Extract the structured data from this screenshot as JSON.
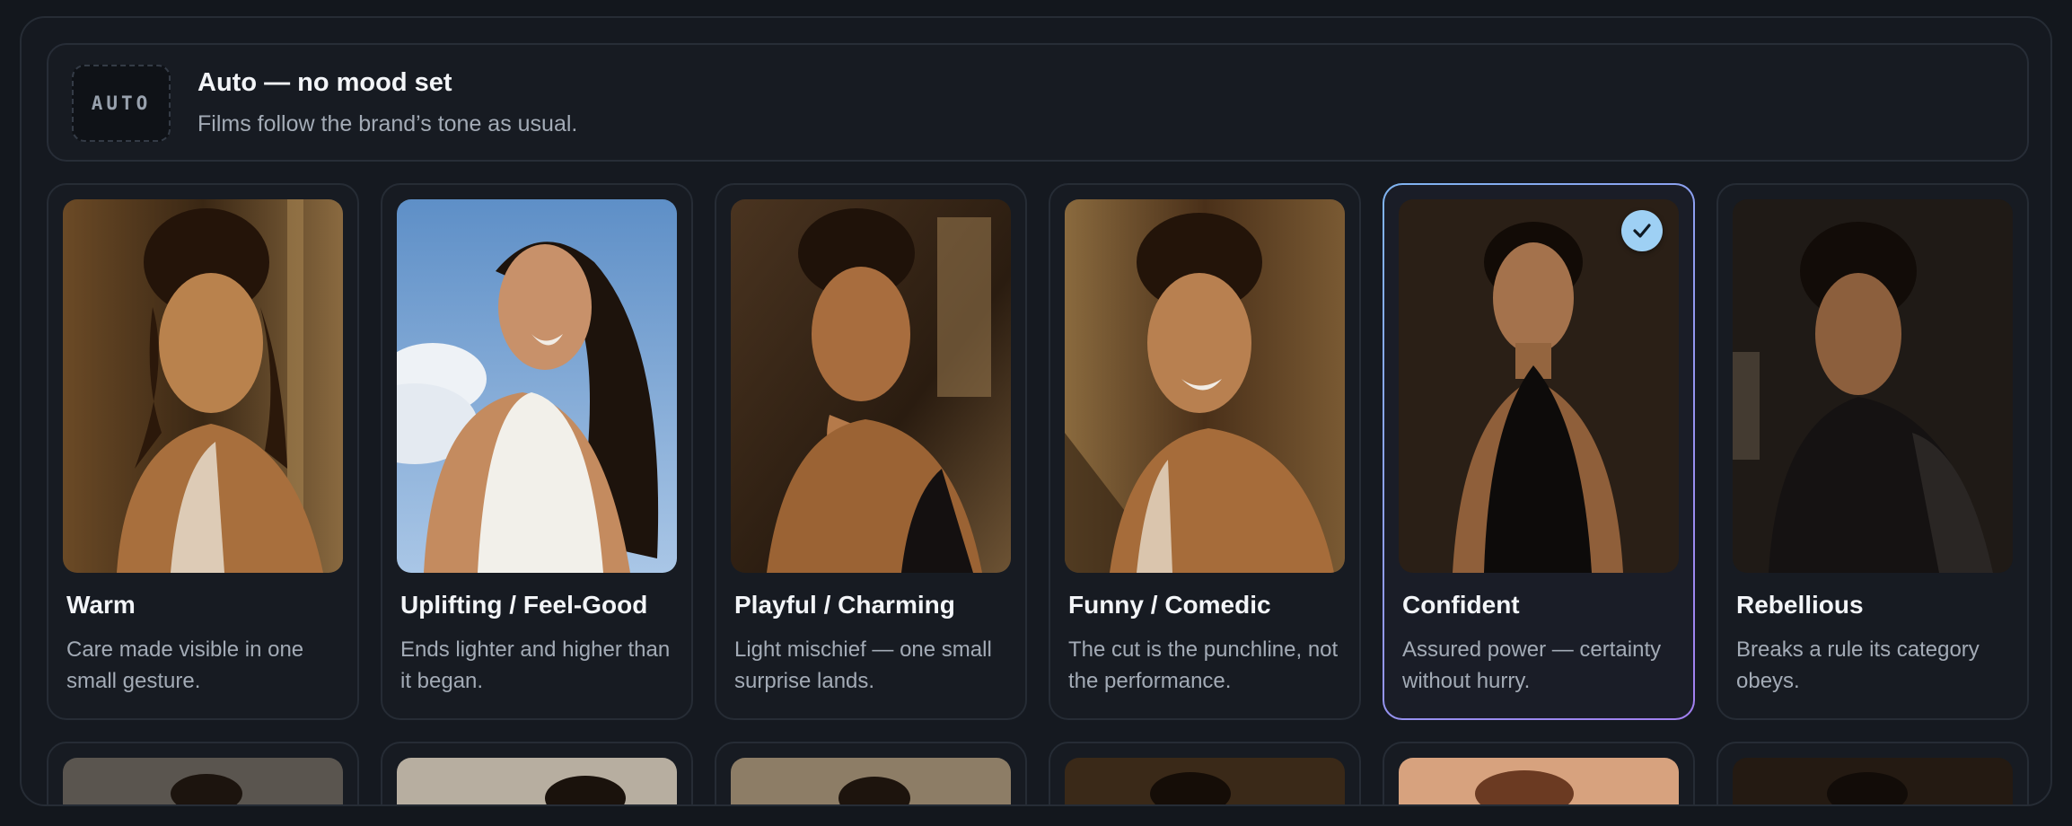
{
  "auto": {
    "badge": "AUTO",
    "title": "Auto — no mood set",
    "subtitle": "Films follow the brand’s tone as usual."
  },
  "moods": [
    {
      "title": "Warm",
      "description": "Care made visible in one small gesture.",
      "selected": false
    },
    {
      "title": "Uplifting / Feel-Good",
      "description": "Ends lighter and higher than it began.",
      "selected": false
    },
    {
      "title": "Playful / Charming",
      "description": "Light mischief — one small surprise lands.",
      "selected": false
    },
    {
      "title": "Funny / Comedic",
      "description": "The cut is the punchline, not the performance.",
      "selected": false
    },
    {
      "title": "Confident",
      "description": "Assured power — certainty without hurry.",
      "selected": true
    },
    {
      "title": "Rebellious",
      "description": "Breaks a rule its category obeys.",
      "selected": false
    }
  ],
  "colors": {
    "selected_border_start": "#7fb4f0",
    "selected_border_end": "#a27ff0",
    "check_badge": "#9ed0f4"
  },
  "icons": {
    "selected_marker": "checkmark-icon"
  }
}
